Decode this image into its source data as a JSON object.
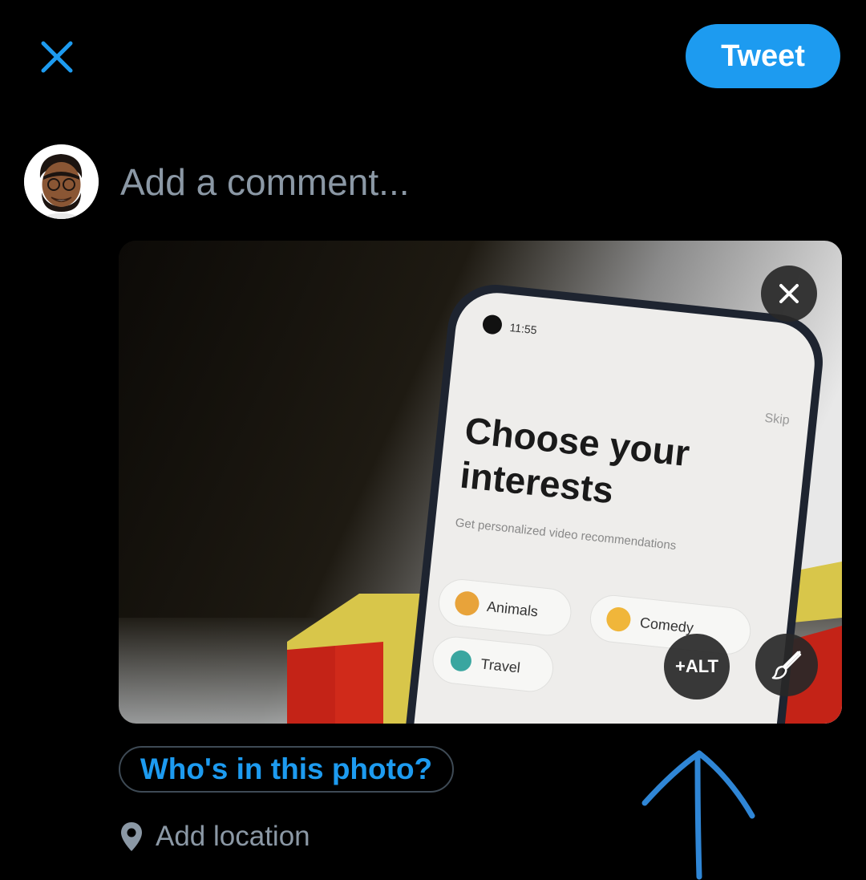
{
  "header": {
    "close_icon": "close-icon",
    "tweet_label": "Tweet"
  },
  "composer": {
    "avatar": "bitmoji-avatar",
    "comment_placeholder": "Add a comment..."
  },
  "media": {
    "remove_icon": "close-icon",
    "alt_label": "+ALT",
    "edit_icon": "paintbrush-icon",
    "photo": {
      "phone_time": "11:55",
      "skip_label": "Skip",
      "heading_line1": "Choose your",
      "heading_line2": "interests",
      "subtitle": "Get personalized video recommendations",
      "chips": [
        "Animals",
        "Comedy",
        "Travel"
      ]
    }
  },
  "actions": {
    "tag_people_label": "Who's in this photo?",
    "location_label": "Add location"
  },
  "colors": {
    "accent": "#1d9bf0",
    "muted_text": "#8b98a5",
    "annotation_arrow": "#2f86d6"
  }
}
